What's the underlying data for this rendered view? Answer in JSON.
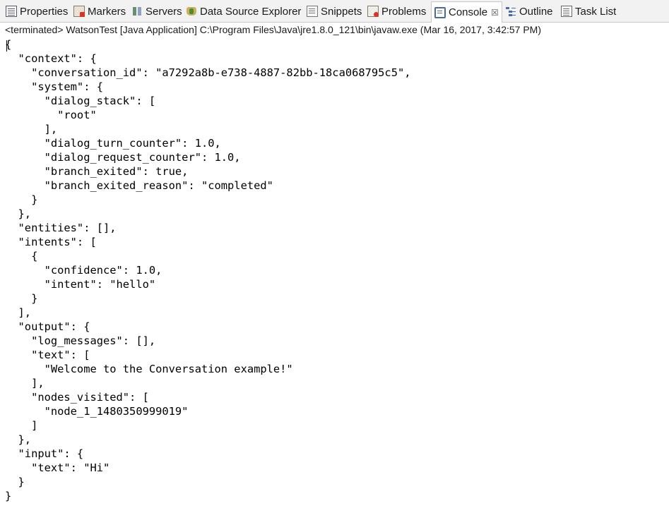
{
  "tabs": [
    {
      "label": "Properties",
      "icon": "properties-icon"
    },
    {
      "label": "Markers",
      "icon": "markers-icon"
    },
    {
      "label": "Servers",
      "icon": "servers-icon"
    },
    {
      "label": "Data Source Explorer",
      "icon": "data-source-explorer-icon"
    },
    {
      "label": "Snippets",
      "icon": "snippets-icon"
    },
    {
      "label": "Problems",
      "icon": "problems-icon"
    },
    {
      "label": "Console",
      "icon": "console-icon",
      "active": true,
      "close_glyph": "☒"
    },
    {
      "label": "Outline",
      "icon": "outline-icon"
    },
    {
      "label": "Task List",
      "icon": "task-list-icon"
    }
  ],
  "status": "<terminated> WatsonTest [Java Application] C:\\Program Files\\Java\\jre1.8.0_121\\bin\\javaw.exe (Mar 16, 2017, 3:42:57 PM)",
  "console_lines": [
    "{",
    "  \"context\": {",
    "    \"conversation_id\": \"a7292a8b-e738-4887-82bb-18ca068795c5\",",
    "    \"system\": {",
    "      \"dialog_stack\": [",
    "        \"root\"",
    "      ],",
    "      \"dialog_turn_counter\": 1.0,",
    "      \"dialog_request_counter\": 1.0,",
    "      \"branch_exited\": true,",
    "      \"branch_exited_reason\": \"completed\"",
    "    }",
    "  },",
    "  \"entities\": [],",
    "  \"intents\": [",
    "    {",
    "      \"confidence\": 1.0,",
    "      \"intent\": \"hello\"",
    "    }",
    "  ],",
    "  \"output\": {",
    "    \"log_messages\": [],",
    "    \"text\": [",
    "      \"Welcome to the Conversation example!\"",
    "    ],",
    "    \"nodes_visited\": [",
    "      \"node_1_1480350999019\"",
    "    ]",
    "  },",
    "  \"input\": {",
    "    \"text\": \"Hi\"",
    "  }",
    "}"
  ]
}
